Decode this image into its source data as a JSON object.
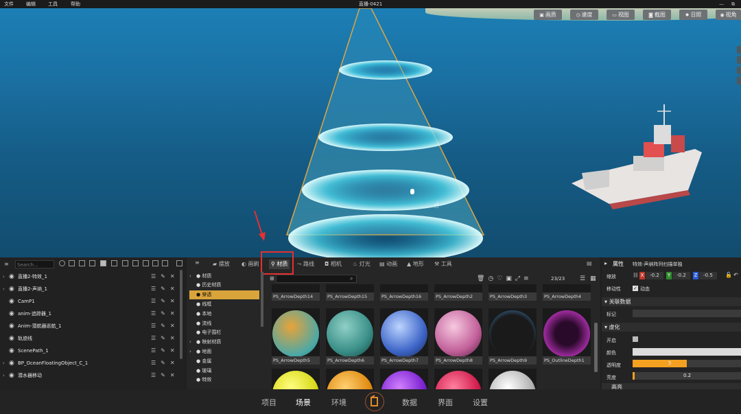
{
  "menu": {
    "file": "文件",
    "edit": "编辑",
    "tools": "工具",
    "help": "帮助"
  },
  "window_title": "直播-0421",
  "viewport_buttons": [
    {
      "label": "画质",
      "icon": "image-icon"
    },
    {
      "label": "速度",
      "icon": "speed-icon"
    },
    {
      "label": "视图",
      "icon": "view-icon"
    },
    {
      "label": "截图",
      "icon": "camera-icon"
    },
    {
      "label": "日照",
      "icon": "sun-icon"
    },
    {
      "label": "视角",
      "icon": "eye-icon"
    }
  ],
  "outliner": {
    "search_placeholder": "Search...",
    "items": [
      {
        "arrow": "›",
        "label": "直播2-特效_1"
      },
      {
        "arrow": "›",
        "label": "直播2-声纳_1"
      },
      {
        "arrow": "",
        "label": "CamP1"
      },
      {
        "arrow": "",
        "label": "anim-追踪器_1"
      },
      {
        "arrow": "",
        "label": "Anim-潜航器巡航_1"
      },
      {
        "arrow": "",
        "label": "轨迹线"
      },
      {
        "arrow": "",
        "label": "ScenePath_1"
      },
      {
        "arrow": "›",
        "label": "BP_OceanFloatingObject_C_1"
      },
      {
        "arrow": "›",
        "label": "潜水器移动"
      }
    ]
  },
  "library": {
    "tabs": [
      "摆放",
      "画刷",
      "材质",
      "路线",
      "相机",
      "灯光",
      "动画",
      "地形",
      "工具"
    ],
    "active_tab": "材质",
    "categories": [
      {
        "prefix": "›",
        "label": "材质"
      },
      {
        "prefix": "",
        "label": "历史材质"
      },
      {
        "prefix": "",
        "label": "穿透"
      },
      {
        "prefix": "",
        "label": "线框"
      },
      {
        "prefix": "",
        "label": "本地"
      },
      {
        "prefix": "",
        "label": "流线"
      },
      {
        "prefix": "",
        "label": "电子围栏"
      },
      {
        "prefix": "›",
        "label": "映射材质"
      },
      {
        "prefix": "›",
        "label": "地面"
      },
      {
        "prefix": "",
        "label": "金属"
      },
      {
        "prefix": "",
        "label": "玻璃"
      },
      {
        "prefix": "",
        "label": "特效"
      }
    ],
    "count": "23/23",
    "top_row": [
      "PS_ArrowDepth14",
      "PS_ArrowDepth15",
      "PS_ArrowDepth16",
      "PS_ArrowDepth2",
      "PS_ArrowDepth3",
      "PS_ArrowDepth4"
    ],
    "mid_row": [
      "PS_ArrowDepth5",
      "PS_ArrowDepth6",
      "PS_ArrowDepth7",
      "PS_ArrowDepth8",
      "PS_ArrowDepth9",
      "PS_OutlineDepth1"
    ]
  },
  "properties": {
    "header": "属性",
    "object": "特效-声纳阵列扫描单独",
    "scale_label": "缩放",
    "x": "-0.2",
    "y": "-0.2",
    "z": "-0.5",
    "mobility_label": "移动性",
    "mobility_value": "动态",
    "linked_section": "关联数据",
    "tag_label": "标记",
    "fade_section": "虚化",
    "enable_label": "开启",
    "color_label": "颜色",
    "opacity_label": "透明度",
    "opacity_value": "5",
    "opacity_fraction": 0.5,
    "brightness_label": "亮度",
    "brightness_value": "0.2",
    "brightness_fraction": 0.02,
    "cut_section": "高亮"
  },
  "bottom_nav": [
    "项目",
    "场景",
    "环境",
    "数据",
    "界面",
    "设置"
  ],
  "colors": {
    "accent": "#f4a021",
    "selected_category": "#d9a43a",
    "annotation_red": "#e53030"
  }
}
